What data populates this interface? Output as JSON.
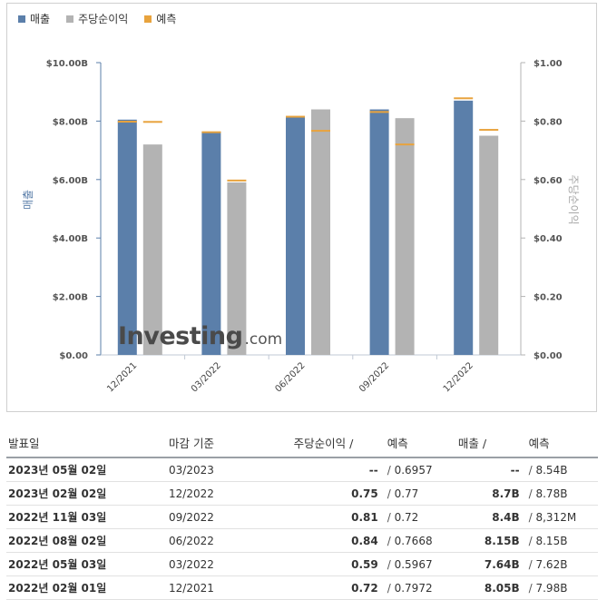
{
  "legend": [
    {
      "label": "매출",
      "color": "#5b7faa"
    },
    {
      "label": "주당순이익",
      "color": "#b3b3b3"
    },
    {
      "label": "예측",
      "color": "#e8a33d"
    }
  ],
  "watermark": {
    "main": "Investing",
    "domain": ".com"
  },
  "chart_data": {
    "type": "bar",
    "categories": [
      "12/2021",
      "03/2022",
      "06/2022",
      "09/2022",
      "12/2022"
    ],
    "series": [
      {
        "name": "매출",
        "axis": "left",
        "values": [
          8.05,
          7.64,
          8.15,
          8.4,
          8.7
        ],
        "forecast": [
          7.98,
          7.62,
          8.15,
          8.312,
          8.78
        ],
        "color": "#5b7faa"
      },
      {
        "name": "주당순이익",
        "axis": "right",
        "values": [
          0.72,
          0.59,
          0.84,
          0.81,
          0.75
        ],
        "forecast": [
          0.7972,
          0.5967,
          0.7668,
          0.72,
          0.77
        ],
        "color": "#b3b3b3"
      }
    ],
    "forecast_color": "#e8a33d",
    "ylabel_left": "매출",
    "ylabel_right": "주당순이익",
    "yticks_left": [
      "$0.00",
      "$2.00B",
      "$4.00B",
      "$6.00B",
      "$8.00B",
      "$10.00B"
    ],
    "yticks_right": [
      "$0.00",
      "$0.20",
      "$0.40",
      "$0.60",
      "$0.80",
      "$1.00"
    ],
    "ylim_left": [
      0,
      10
    ],
    "ylim_right": [
      0,
      1
    ],
    "grid": false,
    "legend_position": "top-left"
  },
  "table": {
    "headers": {
      "date": "발표일",
      "period": "마감 기준",
      "eps": "주당순이익 /",
      "eps_fc": "예측",
      "rev": "매출 /",
      "rev_fc": "예측"
    },
    "rows": [
      {
        "date": "2023년 05월 02일",
        "period": "03/2023",
        "eps": "--",
        "eps_color": "black",
        "eps_fc": "0.6957",
        "rev": "--",
        "rev_color": "black",
        "rev_fc": "8.54B"
      },
      {
        "date": "2023년 02월 02일",
        "period": "12/2022",
        "eps": "0.75",
        "eps_color": "blue",
        "eps_fc": "0.77",
        "rev": "8.7B",
        "rev_color": "blue",
        "rev_fc": "8.78B"
      },
      {
        "date": "2022년 11월 03일",
        "period": "09/2022",
        "eps": "0.81",
        "eps_color": "red",
        "eps_fc": "0.72",
        "rev": "8.4B",
        "rev_color": "red",
        "rev_fc": "8,312M"
      },
      {
        "date": "2022년 08월 02일",
        "period": "06/2022",
        "eps": "0.84",
        "eps_color": "red",
        "eps_fc": "0.7668",
        "rev": "8.15B",
        "rev_color": "black",
        "rev_fc": "8.15B"
      },
      {
        "date": "2022년 05월 03일",
        "period": "03/2022",
        "eps": "0.59",
        "eps_color": "blue",
        "eps_fc": "0.5967",
        "rev": "7.64B",
        "rev_color": "red",
        "rev_fc": "7.62B"
      },
      {
        "date": "2022년 02월 01일",
        "period": "12/2021",
        "eps": "0.72",
        "eps_color": "blue",
        "eps_fc": "0.7972",
        "rev": "8.05B",
        "rev_color": "red",
        "rev_fc": "7.98B"
      }
    ]
  }
}
